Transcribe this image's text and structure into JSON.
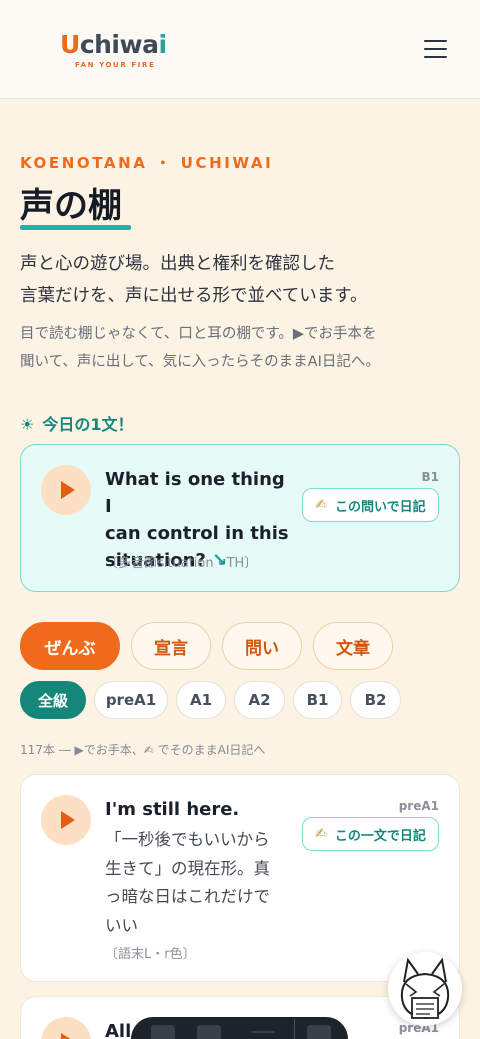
{
  "brand": {
    "u": "U",
    "chiwa": "chiwa",
    "i": "i",
    "tagline": "FAN YOUR FIRE",
    "icon_menu": "hamburger-menu-icon"
  },
  "hero": {
    "eyebrow": "KOENOTANA ・ UCHIWAI",
    "title": "声の棚",
    "lead_1": "声と心の遊び場。出典と権利を確認した",
    "lead_2": "言葉だけを、声に出せる形で並べています。",
    "sub_1": "目で読む棚じゃなくて、口と耳の棚です。▶でお手本を",
    "sub_2": "聞いて、声に出して、気に入ったらそのままAI日記へ。"
  },
  "today": {
    "icon": "☀",
    "label": "今日の1文！",
    "line_1": "What is one thing I",
    "line_2": "can control in this",
    "line_3": "situation?",
    "arrow": "↘",
    "note": "〔多音節situation・TH〕",
    "level": "B1",
    "diary_icon": "✍",
    "diary_label": "この問いで日記"
  },
  "tabs": [
    "ぜんぶ",
    "宣言",
    "問い",
    "文章"
  ],
  "levels": [
    "全級",
    "preA1",
    "A1",
    "A2",
    "B1",
    "B2"
  ],
  "count_text": "117本 ― ▶でお手本、✍ でそのままAI日記へ",
  "items": [
    {
      "title": "I'm still here.",
      "jp_1": "「一秒後でもいいから",
      "jp_2": "生きて」の現在形。真",
      "jp_3": "っ暗な日はこれだけで",
      "jp_4": "いい",
      "note": "〔語末L・r色〕",
      "level": "preA1",
      "diary_icon": "✍",
      "diary_label": "この一文で日記"
    },
    {
      "title": "All",
      "level": "preA1"
    }
  ],
  "colors": {
    "accent_orange": "#f06a1b",
    "accent_teal": "#14867a",
    "background": "#fdf3e4"
  }
}
